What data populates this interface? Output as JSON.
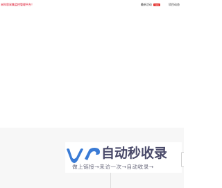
{
  "header": {
    "site_link_text": "米科思采集监控管理平台！",
    "nav": [
      {
        "label": "最新活动",
        "badge": "new"
      },
      {
        "label": "项目动态"
      }
    ]
  },
  "footer": {
    "logo_title": "自动秒收录",
    "logo_slogan": "做上链接→来访一次→自动收录→"
  },
  "colors": {
    "link_red": "#d9001b",
    "badge_red": "#e53935",
    "logo_blue": "#3a7bd5",
    "logo_text": "#4a4a6a",
    "band_grey": "#f7f7f7"
  }
}
